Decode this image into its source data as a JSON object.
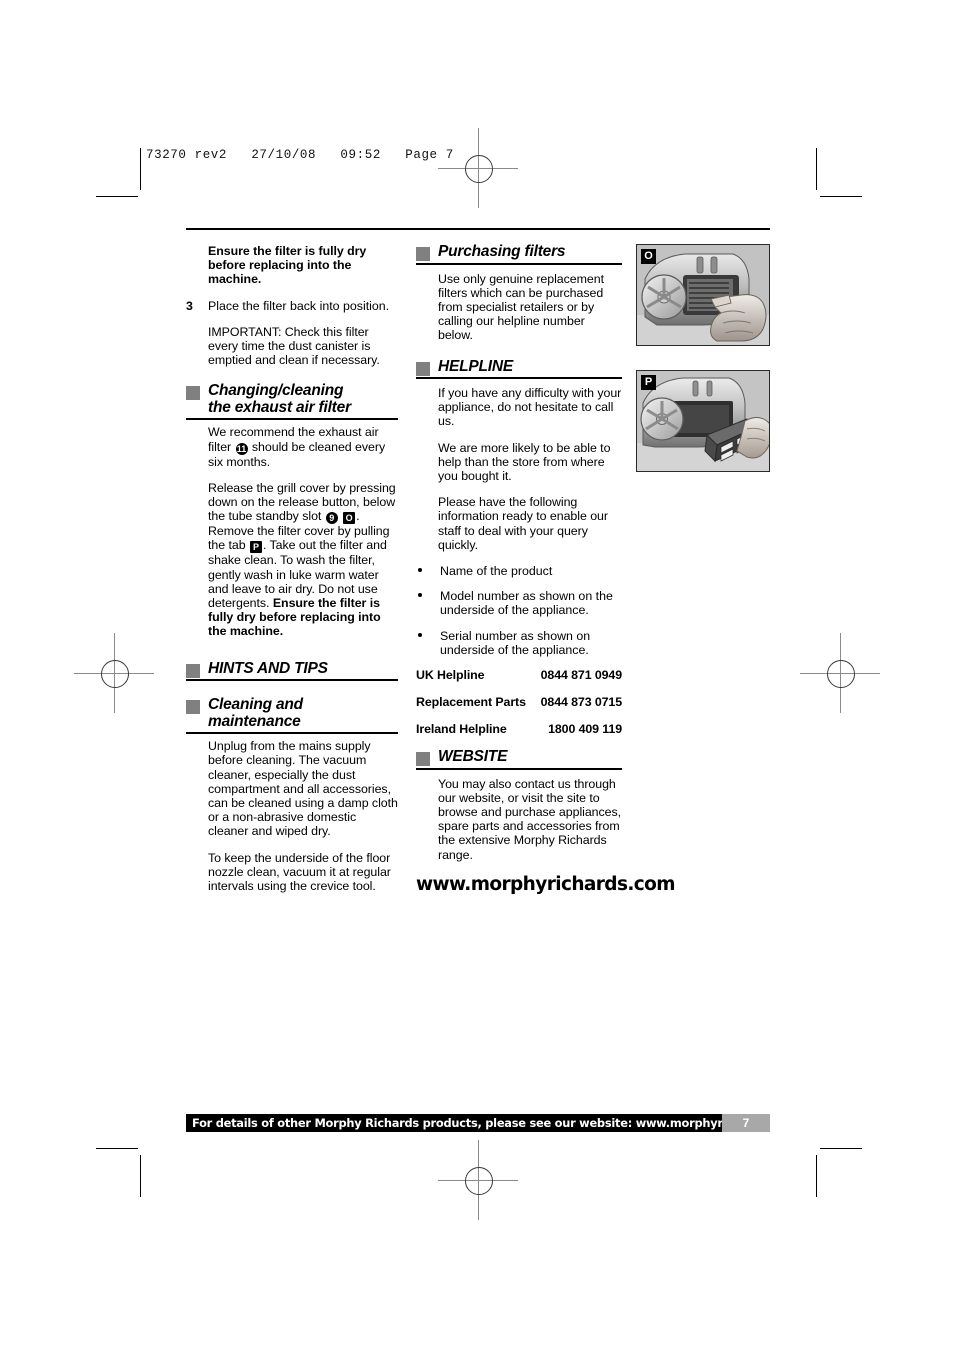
{
  "prepress": {
    "header": "73270 rev2   27/10/08   09:52   Page 7"
  },
  "left_column": {
    "warning_top": "Ensure the filter is fully dry before replacing into the machine.",
    "step_number": "3",
    "step_text": "Place the filter back into position.",
    "important_text": "IMPORTANT: Check this filter every time the dust canister is emptied and clean if necessary.",
    "heading_exhaust_line1": "Changing/cleaning",
    "heading_exhaust_line2": "the exhaust air filter",
    "exhaust_para1_a": "We recommend the exhaust air filter ",
    "exhaust_badge_11": "11",
    "exhaust_para1_b": " should be cleaned every six months.",
    "exhaust_para2_a": "Release the grill cover by pressing down on the release button, below the tube standby slot ",
    "exhaust_badge_9": "9",
    "exhaust_badge_O": "O",
    "exhaust_para2_b": ". Remove the filter cover by pulling the tab ",
    "exhaust_badge_P": "P",
    "exhaust_para2_c": ". Take out the filter and shake clean. To wash the filter, gently wash in luke warm water and leave to air dry. Do not use detergents. ",
    "exhaust_warning": "Ensure the filter is fully dry before replacing into the machine.",
    "heading_hints": "HINTS AND TIPS",
    "heading_cleaning_line1": "Cleaning and",
    "heading_cleaning_line2": "maintenance",
    "cleaning_para1": "Unplug from the mains supply before cleaning. The vacuum cleaner, especially the dust compartment and all accessories, can be cleaned using a damp cloth or a non-abrasive domestic cleaner and wiped dry.",
    "cleaning_para2": "To keep the underside of the floor nozzle clean, vacuum it at regular intervals using the crevice tool."
  },
  "middle_column": {
    "heading_purchasing": "Purchasing filters",
    "purchasing_para": "Use only genuine replacement filters which can be purchased from specialist retailers or by calling our helpline number below.",
    "heading_helpline": "HELPLINE",
    "helpline_para1": "If you have any difficulty with your appliance, do not hesitate to call us.",
    "helpline_para2": "We are more likely to be able to help than the store from where you bought it.",
    "helpline_para3": "Please have the following information ready to enable our staff to deal with your query quickly.",
    "bullets": [
      "Name of the product",
      "Model number as shown on the underside of the appliance.",
      "Serial number as shown on underside of the appliance."
    ],
    "contacts": [
      {
        "label": "UK Helpline",
        "value": "0844 871 0949"
      },
      {
        "label": "Replacement Parts",
        "value": "0844 873 0715"
      },
      {
        "label": "Ireland Helpline",
        "value": "1800 409 119"
      }
    ],
    "heading_website": "WEBSITE",
    "website_para": "You may also contact us through our website, or visit the site to browse and purchase appliances, spare parts and accessories from the extensive Morphy Richards range.",
    "website_url": "www.morphyrichards.com"
  },
  "figures": [
    {
      "label": "O",
      "caption": "vacuum cleaner with hand pressing release button below tube standby slot"
    },
    {
      "label": "P",
      "caption": "vacuum cleaner with exhaust filter and filter cover being removed by hand"
    }
  ],
  "footer": {
    "text": "For details of other Morphy Richards products, please see our website: www.morphyrichards.com",
    "page_number": "7"
  },
  "colors": {
    "heading_square": "#808080",
    "footer_bar": "#000000",
    "footer_page_box": "#a8a8a8"
  }
}
